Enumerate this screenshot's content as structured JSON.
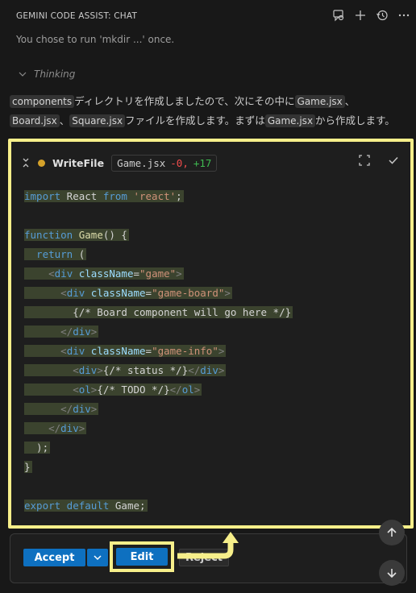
{
  "header": {
    "title": "GEMINI CODE ASSIST: CHAT",
    "icons": [
      "feedback-icon",
      "add-icon",
      "history-icon",
      "more-icon"
    ]
  },
  "message": "You chose to run 'mkdir ...' once.",
  "thinking_label": "Thinking",
  "paragraph": {
    "seg1": "components",
    "seg2": "ディレクトリを作成しましたので、次にその中に",
    "seg3": "Game.jsx",
    "seg4": "、",
    "seg5": "Board.jsx",
    "seg6": "、",
    "seg7": "Square.jsx",
    "seg8": "ファイルを作成します。まずは",
    "seg9": "Game.jsx",
    "seg10": "から作成します。"
  },
  "card": {
    "label": "WriteFile",
    "filename": "Game.jsx",
    "deleted": "-0,",
    "added": "+17"
  },
  "code": {
    "l1a": "import",
    "l1b": " React ",
    "l1c": "from",
    "l1d": " 'react'",
    "l1e": ";",
    "l3a": "function",
    "l3b": " Game",
    "l3c": "() {",
    "l4a": "  return",
    "l4b": " (",
    "l5a": "    <",
    "l5b": "div",
    "l5c": " className",
    "l5d": "=",
    "l5e": "\"game\"",
    "l5f": ">",
    "l6a": "      <",
    "l6b": "div",
    "l6c": " className",
    "l6d": "=",
    "l6e": "\"game-board\"",
    "l6f": ">",
    "l7a": "        {/* Board component will go here */}",
    "l8a": "      </",
    "l8b": "div",
    "l8c": ">",
    "l9a": "      <",
    "l9b": "div",
    "l9c": " className",
    "l9d": "=",
    "l9e": "\"game-info\"",
    "l9f": ">",
    "l10a": "        <",
    "l10b": "div",
    "l10c": ">",
    "l10d": "{/* status */}",
    "l10e": "</",
    "l10f": "div",
    "l10g": ">",
    "l11a": "        <",
    "l11b": "ol",
    "l11c": ">",
    "l11d": "{/* TODO */}",
    "l11e": "</",
    "l11f": "ol",
    "l11g": ">",
    "l12a": "      </",
    "l12b": "div",
    "l12c": ">",
    "l13a": "    </",
    "l13b": "div",
    "l13c": ">",
    "l14a": "  );",
    "l15a": "}",
    "l17a": "export",
    "l17b": " default",
    "l17c": " Game;"
  },
  "buttons": {
    "accept": "Accept",
    "edit": "Edit",
    "reject": "Reject"
  },
  "colors": {
    "highlight": "#f7ef8a",
    "primary": "#0e70c0"
  }
}
